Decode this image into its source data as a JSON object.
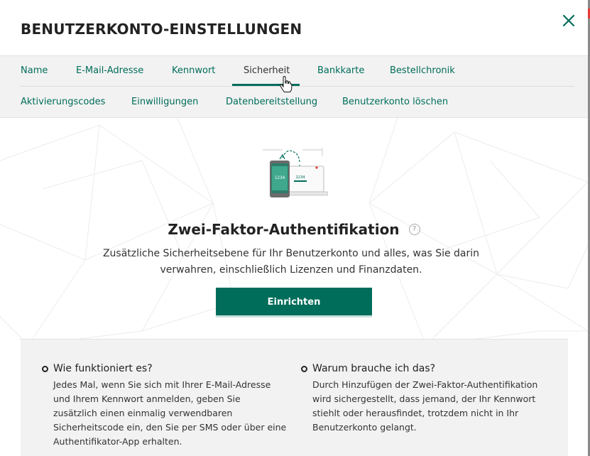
{
  "window": {
    "title": "BENUTZERKONTO-EINSTELLUNGEN",
    "close_icon": "close-x-icon"
  },
  "tabs": {
    "row1": [
      "Name",
      "E-Mail-Adresse",
      "Kennwort",
      "Sicherheit",
      "Bankkarte",
      "Bestellchronik"
    ],
    "row2": [
      "Aktivierungscodes",
      "Einwilligungen",
      "Datenbereitstellung",
      "Benutzerkonto löschen"
    ],
    "active": "Sicherheit"
  },
  "main": {
    "illustration": "phone-laptop-code-icon",
    "illustration_code_phone": "1234",
    "illustration_code_laptop": "1234",
    "heading": "Zwei-Faktor-Authentifikation",
    "help_icon": "?",
    "description_line1": "Zusätzliche Sicherheitsebene für Ihr Benutzerkonto und alles, was Sie darin",
    "description_line2": "verwahren, einschließlich Lizenzen und Finanzdaten.",
    "button_label": "Einrichten"
  },
  "info": {
    "how": {
      "title": "Wie funktioniert es?",
      "lines": [
        "Jedes Mal, wenn Sie sich mit Ihrer E-Mail-Adresse",
        "und Ihrem Kennwort anmelden, geben Sie",
        "zusätzlich einen einmalig verwendbaren",
        "Sicherheitscode ein, den Sie per SMS oder über eine",
        "Authentifikator-App erhalten."
      ]
    },
    "why": {
      "title": "Warum brauche ich das?",
      "lines": [
        "Durch Hinzufügen der Zwei-Faktor-Authentifikation",
        "wird sichergestellt, dass jemand, der Ihr Kennwort",
        "stiehlt oder herausfindet, trotzdem nicht in Ihr",
        "Benutzerkonto gelangt."
      ]
    }
  },
  "colors": {
    "accent": "#006d5b",
    "tab_bg": "#f2f2f2",
    "text": "#222222"
  }
}
